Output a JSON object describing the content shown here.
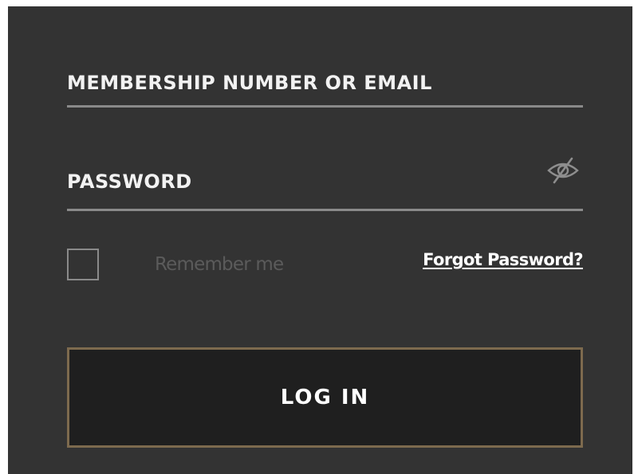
{
  "login_form": {
    "email_field": {
      "placeholder": "MEMBERSHIP NUMBER OR EMAIL",
      "value": ""
    },
    "password_field": {
      "placeholder": "PASSWORD",
      "value": "",
      "visibility_icon": "eye-off-icon"
    },
    "remember_me": {
      "label": "Remember me",
      "checked": false
    },
    "forgot_password_label": "Forgot Password?",
    "login_button_label": "LOG IN"
  },
  "colors": {
    "panel_background": "#333333",
    "button_background": "#1f1f1f",
    "button_border": "#7d6a4e",
    "divider": "#8a8a8a",
    "muted_text": "#5b5b5b",
    "text": "#ffffff"
  }
}
